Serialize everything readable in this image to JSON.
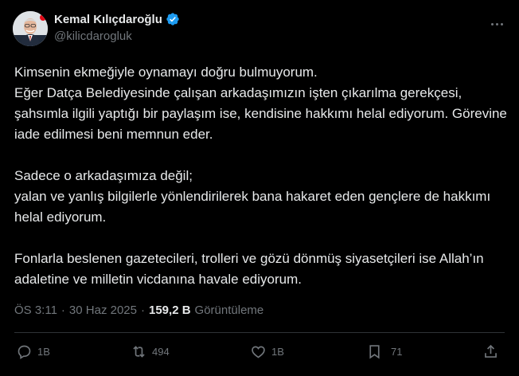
{
  "author": {
    "name": "Kemal Kılıçdaroğlu",
    "handle": "@kilicdarogluk"
  },
  "post": {
    "paragraphs": [
      "Kimsenin ekmeğiyle oynamayı doğru bulmuyorum.\nEğer Datça Belediyesinde çalışan arkadaşımızın işten çıkarılma gerekçesi, şahsımla ilgili yaptığı bir paylaşım ise, kendisine hakkımı helal ediyorum. Görevine iade edilmesi beni memnun eder.",
      "Sadece o arkadaşımıza değil;\nyalan ve yanlış bilgilerle yönlendirilerek bana hakaret eden gençlere de hakkımı helal ediyorum.",
      "Fonlarla beslenen gazetecileri, trolleri ve gözü dönmüş siyasetçileri ise Allah’ın adaletine ve milletin vicdanına havale ediyorum."
    ]
  },
  "meta": {
    "time": "ÖS 3:11",
    "dot1": "·",
    "date": "30 Haz 2025",
    "dot2": "·",
    "views_count": "159,2 B",
    "views_label": "Görüntüleme"
  },
  "actions": {
    "replies": "1B",
    "reposts": "494",
    "likes": "1B",
    "bookmarks": "71"
  },
  "colors": {
    "background": "#000000",
    "text": "#e7e9ea",
    "muted": "#71767b",
    "verified": "#1d9bf0",
    "divider": "#2f3336"
  },
  "icons": [
    "verified-badge-icon",
    "more-icon",
    "reply-icon",
    "repost-icon",
    "like-icon",
    "bookmark-icon",
    "share-icon"
  ]
}
